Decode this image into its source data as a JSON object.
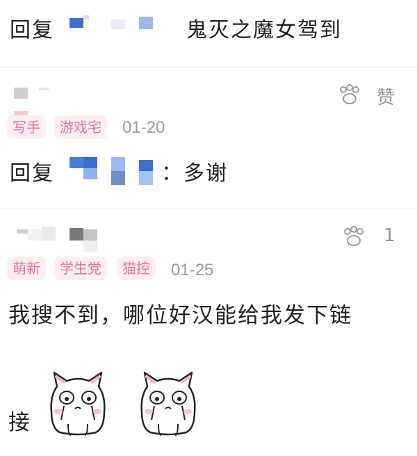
{
  "comments": [
    {
      "reply_prefix": "回复",
      "text": "鬼灭之魔女驾到"
    },
    {
      "tags": [
        "写手",
        "游戏宅"
      ],
      "date": "01-20",
      "like_count": "赞",
      "reply_prefix": "回复",
      "reply_suffix": "：多谢"
    },
    {
      "tags": [
        "萌新",
        "学生党",
        "猫控"
      ],
      "date": "01-25",
      "like_count": "1",
      "text_line1": "我搜不到，哪位好汉能给我发下链",
      "text_line2": "接"
    }
  ],
  "icons": {
    "like": "paw-icon",
    "sticker": "crying-cat-sticker"
  },
  "colors": {
    "tag_bg": "#fdeef1",
    "tag_text": "#e3778f",
    "divider": "#eeeeee",
    "mosaic_blue": "#3a72d8"
  }
}
